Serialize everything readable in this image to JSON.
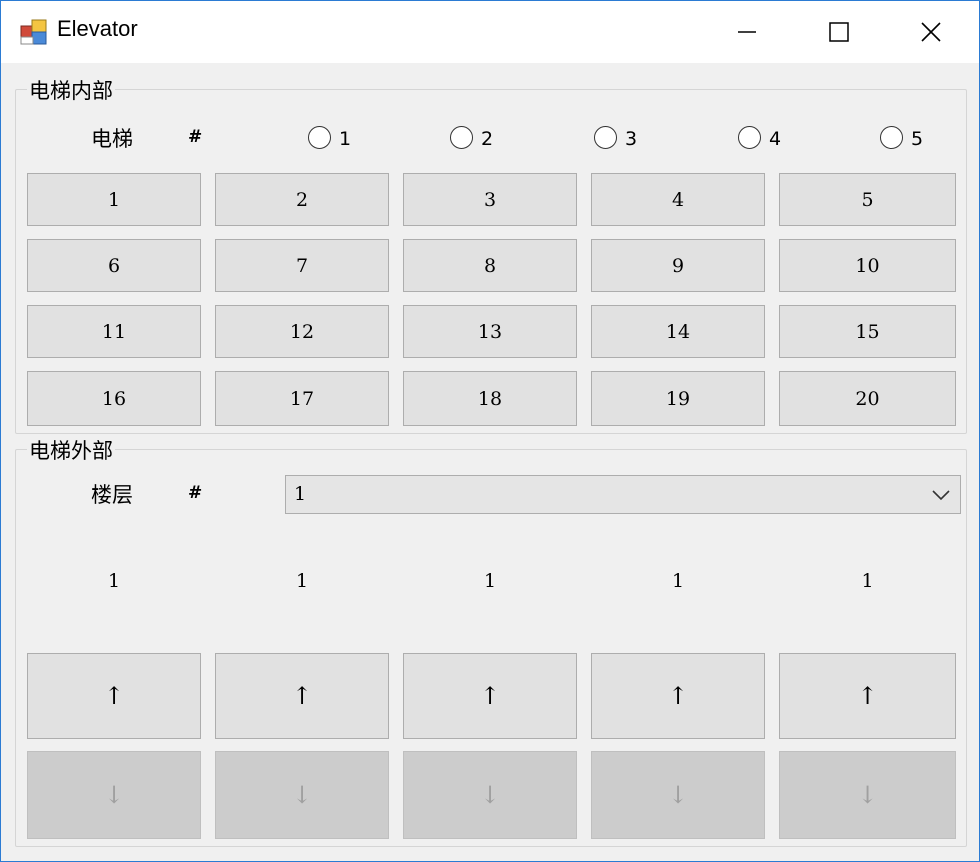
{
  "window": {
    "title": "Elevator"
  },
  "inside": {
    "group_label": "电梯内部",
    "elevator_label": "电梯",
    "hash": "#",
    "radios": [
      "1",
      "2",
      "3",
      "4",
      "5"
    ],
    "floor_buttons": [
      "1",
      "2",
      "3",
      "4",
      "5",
      "6",
      "7",
      "8",
      "9",
      "10",
      "11",
      "12",
      "13",
      "14",
      "15",
      "16",
      "17",
      "18",
      "19",
      "20"
    ]
  },
  "outside": {
    "group_label": "电梯外部",
    "floor_label": "楼层",
    "hash": "#",
    "selected_floor": "1",
    "elevator_floors": [
      "1",
      "1",
      "1",
      "1",
      "1"
    ],
    "up_label": "↑",
    "down_label": "↓"
  },
  "icons": {
    "minimize": "minimize-icon",
    "maximize": "maximize-icon",
    "close": "close-icon",
    "app": "app-icon",
    "dropdown": "chevron-down-icon"
  }
}
